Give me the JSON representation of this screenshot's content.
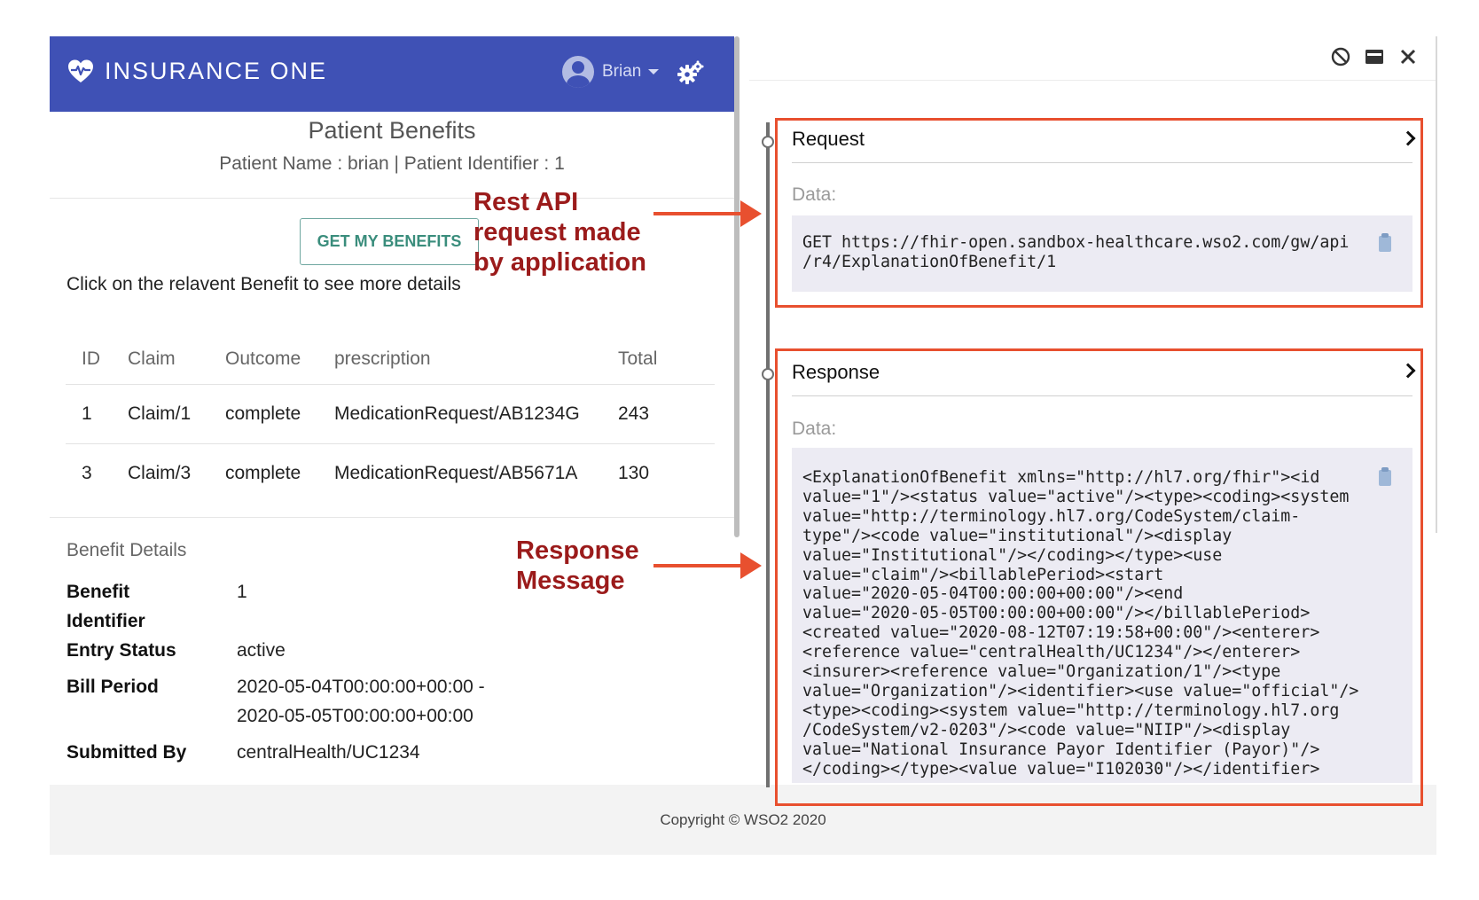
{
  "app": {
    "brand": "INSURANCE ONE",
    "user_name": "Brian",
    "page_title": "Patient Benefits",
    "patient_line": "Patient Name : brian | Patient Identifier : 1",
    "get_benefits_button": "GET MY BENEFITS",
    "hint": "Click on the relavent Benefit to see more details",
    "table": {
      "headers": [
        "ID",
        "Claim",
        "Outcome",
        "prescription",
        "Total"
      ],
      "rows": [
        [
          "1",
          "Claim/1",
          "complete",
          "MedicationRequest/AB1234G",
          "243"
        ],
        [
          "3",
          "Claim/3",
          "complete",
          "MedicationRequest/AB5671A",
          "130"
        ]
      ]
    },
    "benefit_details": {
      "title": "Benefit Details",
      "benefit_identifier_label": "Benefit Identifier",
      "benefit_identifier_value": "1",
      "entry_status_label": "Entry Status",
      "entry_status_value": "active",
      "bill_period_label": "Bill Period",
      "bill_period_start": "2020-05-04T00:00:00+00:00 -",
      "bill_period_end": "2020-05-05T00:00:00+00:00",
      "submitted_by_label": "Submitted By",
      "submitted_by_value": "centralHealth/UC1234"
    }
  },
  "footer": {
    "copyright": "Copyright © WSO2 2020"
  },
  "annotations": {
    "request_1": "Rest API",
    "request_2": "request made",
    "request_3": "by application",
    "response_1": "Response",
    "response_2": "Message"
  },
  "panel": {
    "request": {
      "title": "Request",
      "data_label": "Data:",
      "code": "GET https://fhir-open.sandbox-healthcare.wso2.com/gw/api\n/r4/ExplanationOfBenefit/1"
    },
    "response": {
      "title": "Response",
      "data_label": "Data:",
      "code": "<ExplanationOfBenefit xmlns=\"http://hl7.org/fhir\"><id\nvalue=\"1\"/><status value=\"active\"/><type><coding><system\nvalue=\"http://terminology.hl7.org/CodeSystem/claim-\ntype\"/><code value=\"institutional\"/><display\nvalue=\"Institutional\"/></coding></type><use\nvalue=\"claim\"/><billablePeriod><start\nvalue=\"2020-05-04T00:00:00+00:00\"/><end\nvalue=\"2020-05-05T00:00:00+00:00\"/></billablePeriod>\n<created value=\"2020-08-12T07:19:58+00:00\"/><enterer>\n<reference value=\"centralHealth/UC1234\"/></enterer>\n<insurer><reference value=\"Organization/1\"/><type\nvalue=\"Organization\"/><identifier><use value=\"official\"/>\n<type><coding><system value=\"http://terminology.hl7.org\n/CodeSystem/v2-0203\"/><code value=\"NIIP\"/><display\nvalue=\"National Insurance Payor Identifier (Payor)\"/>\n</coding></type><value value=\"I102030\"/></identifier>"
    }
  },
  "icons": [
    "heart-pulse-icon",
    "user-avatar-icon",
    "caret-down-icon",
    "settings-gears-icon",
    "clear-icon",
    "minimize-icon",
    "close-icon",
    "chevron-right-icon",
    "clipboard-icon"
  ],
  "colors": {
    "header_blue": "#3f51b5",
    "annotation_red": "#9b1b1b",
    "highlight_orange": "#e8502f",
    "button_green": "#3a8d7c"
  }
}
